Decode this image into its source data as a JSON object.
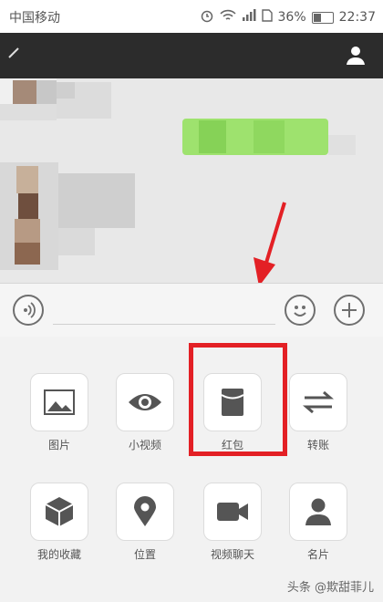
{
  "status_bar": {
    "carrier": "中国移动",
    "battery": "36%",
    "time": "22:37"
  },
  "panel": {
    "items": [
      {
        "label": "图片",
        "icon": "image-icon"
      },
      {
        "label": "小视频",
        "icon": "eye-icon"
      },
      {
        "label": "红包",
        "icon": "red-envelope-icon"
      },
      {
        "label": "转账",
        "icon": "transfer-icon"
      },
      {
        "label": "我的收藏",
        "icon": "cube-icon"
      },
      {
        "label": "位置",
        "icon": "location-pin-icon"
      },
      {
        "label": "视频聊天",
        "icon": "video-camera-icon"
      },
      {
        "label": "名片",
        "icon": "person-card-icon"
      }
    ]
  },
  "watermark": "头条 @欺甜菲儿",
  "colors": {
    "highlight": "#e32025",
    "titlebar": "#2c2c2c",
    "bubble": "#9ee26e"
  }
}
